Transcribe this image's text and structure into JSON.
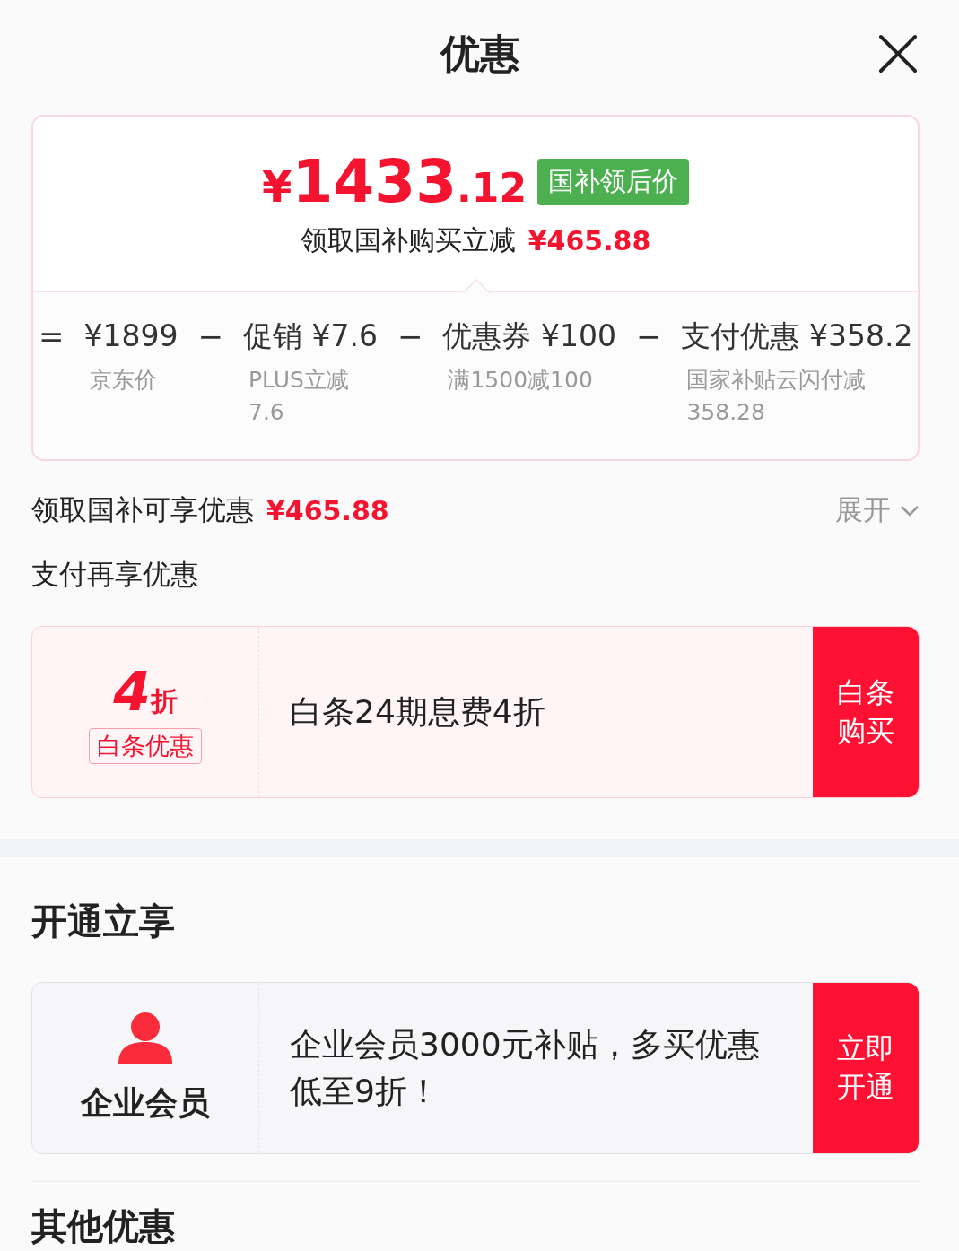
{
  "header": {
    "title": "优惠"
  },
  "summary": {
    "currency": "¥",
    "price_int": "1433",
    "price_dec": ".12",
    "badge": "国补领后价",
    "subtitle": "领取国补购买立减",
    "subtitle_amount": "¥465.88"
  },
  "breakdown": [
    {
      "operator": "=",
      "value": "¥1899",
      "label": "京东价"
    },
    {
      "operator": "−",
      "value": "促销 ¥7.6",
      "label": "PLUS立减 7.6"
    },
    {
      "operator": "−",
      "value": "优惠券 ¥100",
      "label": "满1500减100"
    },
    {
      "operator": "−",
      "value": "支付优惠 ¥358.2",
      "label": "国家补贴云闪付减 358.28"
    }
  ],
  "gov_subsidy": {
    "label": "领取国补可享优惠",
    "amount": "¥465.88",
    "toggle": "展开",
    "expanded": false
  },
  "pay_section": {
    "title": "支付再享优惠",
    "offers": [
      {
        "discount": "4",
        "unit": "折",
        "tag": "白条优惠",
        "description": "白条24期息费4折",
        "action": "白条购买"
      }
    ]
  },
  "open_section": {
    "title": "开通立享",
    "offers": [
      {
        "name": "企业会员",
        "description": "企业会员3000元补贴，多买优惠低至9折！",
        "action": "立即开通"
      }
    ]
  },
  "other_section": {
    "title": "其他优惠"
  }
}
